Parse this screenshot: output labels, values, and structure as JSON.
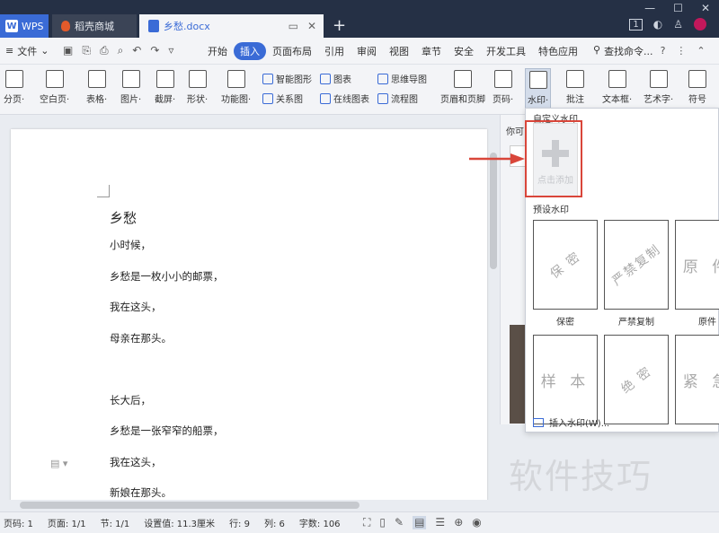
{
  "titlebar": {
    "tabs": [
      {
        "label": "WPS"
      },
      {
        "label": "稻壳商城"
      },
      {
        "label": "乡愁.docx"
      }
    ],
    "page_count_badge": "1"
  },
  "menubar": {
    "file_label": "文件",
    "menus": [
      "开始",
      "插入",
      "页面布局",
      "引用",
      "审阅",
      "视图",
      "章节",
      "安全",
      "开发工具",
      "特色应用"
    ],
    "active_menu": "插入",
    "search_label": "查找命令..."
  },
  "ribbon": {
    "large_buttons": [
      {
        "label": "分页·",
        "icon": "page-break-icon"
      },
      {
        "label": "空白页·",
        "icon": "blank-page-icon"
      },
      {
        "label": "表格·",
        "icon": "table-icon"
      },
      {
        "label": "图片·",
        "icon": "picture-icon"
      },
      {
        "label": "截屏·",
        "icon": "screenshot-icon"
      },
      {
        "label": "形状·",
        "icon": "shape-icon"
      },
      {
        "label": "功能图·",
        "icon": "function-chart-icon"
      },
      {
        "label": "页眉和页脚",
        "icon": "header-footer-icon"
      },
      {
        "label": "页码·",
        "icon": "page-number-icon"
      },
      {
        "label": "水印·",
        "icon": "watermark-icon"
      },
      {
        "label": "批注",
        "icon": "comment-icon"
      },
      {
        "label": "文本框·",
        "icon": "textbox-icon"
      },
      {
        "label": "艺术字·",
        "icon": "art-text-icon"
      },
      {
        "label": "符号",
        "icon": "symbol-icon"
      }
    ],
    "small_buttons": [
      {
        "label": "智能图形",
        "icon": "smart-graphic-icon"
      },
      {
        "label": "图表",
        "icon": "chart-icon"
      },
      {
        "label": "思维导图",
        "icon": "mindmap-icon"
      },
      {
        "label": "关系图",
        "icon": "relation-icon"
      },
      {
        "label": "在线图表",
        "icon": "online-chart-icon"
      },
      {
        "label": "流程图",
        "icon": "flowchart-icon"
      }
    ]
  },
  "document": {
    "title": "乡愁",
    "lines": [
      "小时候，",
      "乡愁是一枚小小的邮票，",
      "我在这头，",
      "母亲在那头。",
      "",
      "长大后，",
      "乡愁是一张窄窄的船票，",
      "我在这头，",
      "新娘在那头。"
    ]
  },
  "taskpane": {
    "label": "你可"
  },
  "watermark_menu": {
    "custom_title": "自定义水印",
    "add_label": "点击添加",
    "preset_title": "预设水印",
    "presets": [
      {
        "text": "保 密",
        "label": "保密"
      },
      {
        "text": "严禁复制",
        "label": "严禁复制"
      },
      {
        "text": "原 件",
        "label": "原件"
      },
      {
        "text": "样 本",
        "label": ""
      },
      {
        "text": "绝 密",
        "label": ""
      },
      {
        "text": "紧 急",
        "label": ""
      }
    ],
    "insert_label": "插入水印(W)..."
  },
  "overlay_watermark": "软件技巧",
  "statusbar": {
    "items": [
      "页码: 1",
      "页面: 1/1",
      "节: 1/1",
      "设置值: 11.3厘米",
      "行: 9",
      "列: 6",
      "字数: 106"
    ]
  },
  "colors": {
    "accent": "#3a6bd6",
    "titlebar": "#253045",
    "highlight_frame": "#d9463a"
  }
}
